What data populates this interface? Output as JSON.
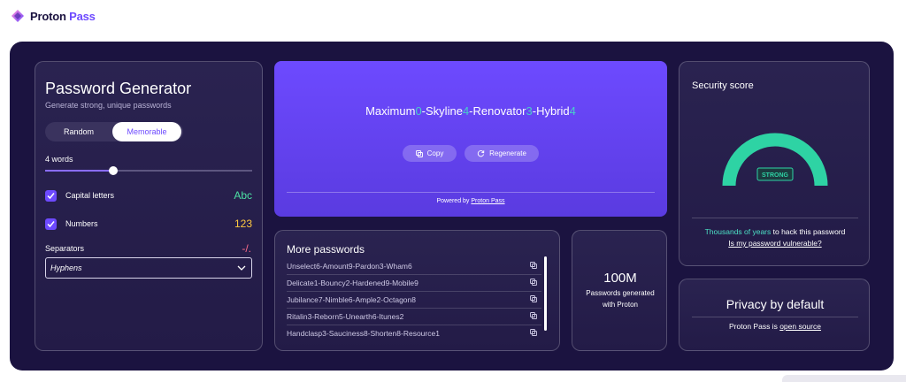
{
  "brand": {
    "name_main": "Proton",
    "name_accent": "Pass",
    "logo_icon": "proton-pass-logo"
  },
  "generator": {
    "title": "Password Generator",
    "subtitle": "Generate strong, unique passwords",
    "modes": [
      "Random",
      "Memorable"
    ],
    "selected_mode": "Memorable",
    "words_label": "4 words",
    "words_slider_fraction": 0.33,
    "options": [
      {
        "label": "Capital letters",
        "sample": "Abc",
        "checked": true,
        "sample_color": "#4ce0a4"
      },
      {
        "label": "Numbers",
        "sample": "123",
        "checked": true,
        "sample_color": "#ffc940"
      }
    ],
    "separators_label": "Separators",
    "separators_sample": "-/.",
    "separator_value": "Hyphens"
  },
  "password": {
    "parts": [
      "Maximum",
      "0",
      "-",
      "Skyline",
      "4",
      "-",
      "Renovator",
      "3",
      "-",
      "Hybrid",
      "4"
    ],
    "copy_label": "Copy",
    "regenerate_label": "Regenerate",
    "powered_prefix": "Powered by",
    "powered_link": "Proton Pass"
  },
  "more_passwords": {
    "title": "More passwords",
    "items": [
      "Unselect6-Amount9-Pardon3-Wham6",
      "Delicate1-Bouncy2-Hardened9-Mobile9",
      "Jubilance7-Nimble6-Ample2-Octagon8",
      "Ritalin3-Reborn5-Unearth6-Itunes2",
      "Handclasp3-Sauciness8-Shorten8-Resource1"
    ]
  },
  "stat": {
    "value": "100M",
    "label": "Passwords generated with Proton"
  },
  "security": {
    "title": "Security score",
    "badge": "STRONG",
    "gauge_fraction": 1.0,
    "highlight": "Thousands of years",
    "line1_rest": " to hack this password",
    "link": "Is my password vulnerable?",
    "accent_color": "#2ed3a4"
  },
  "privacy": {
    "title": "Privacy by default",
    "text_prefix": "Proton Pass is ",
    "link": "open source"
  }
}
